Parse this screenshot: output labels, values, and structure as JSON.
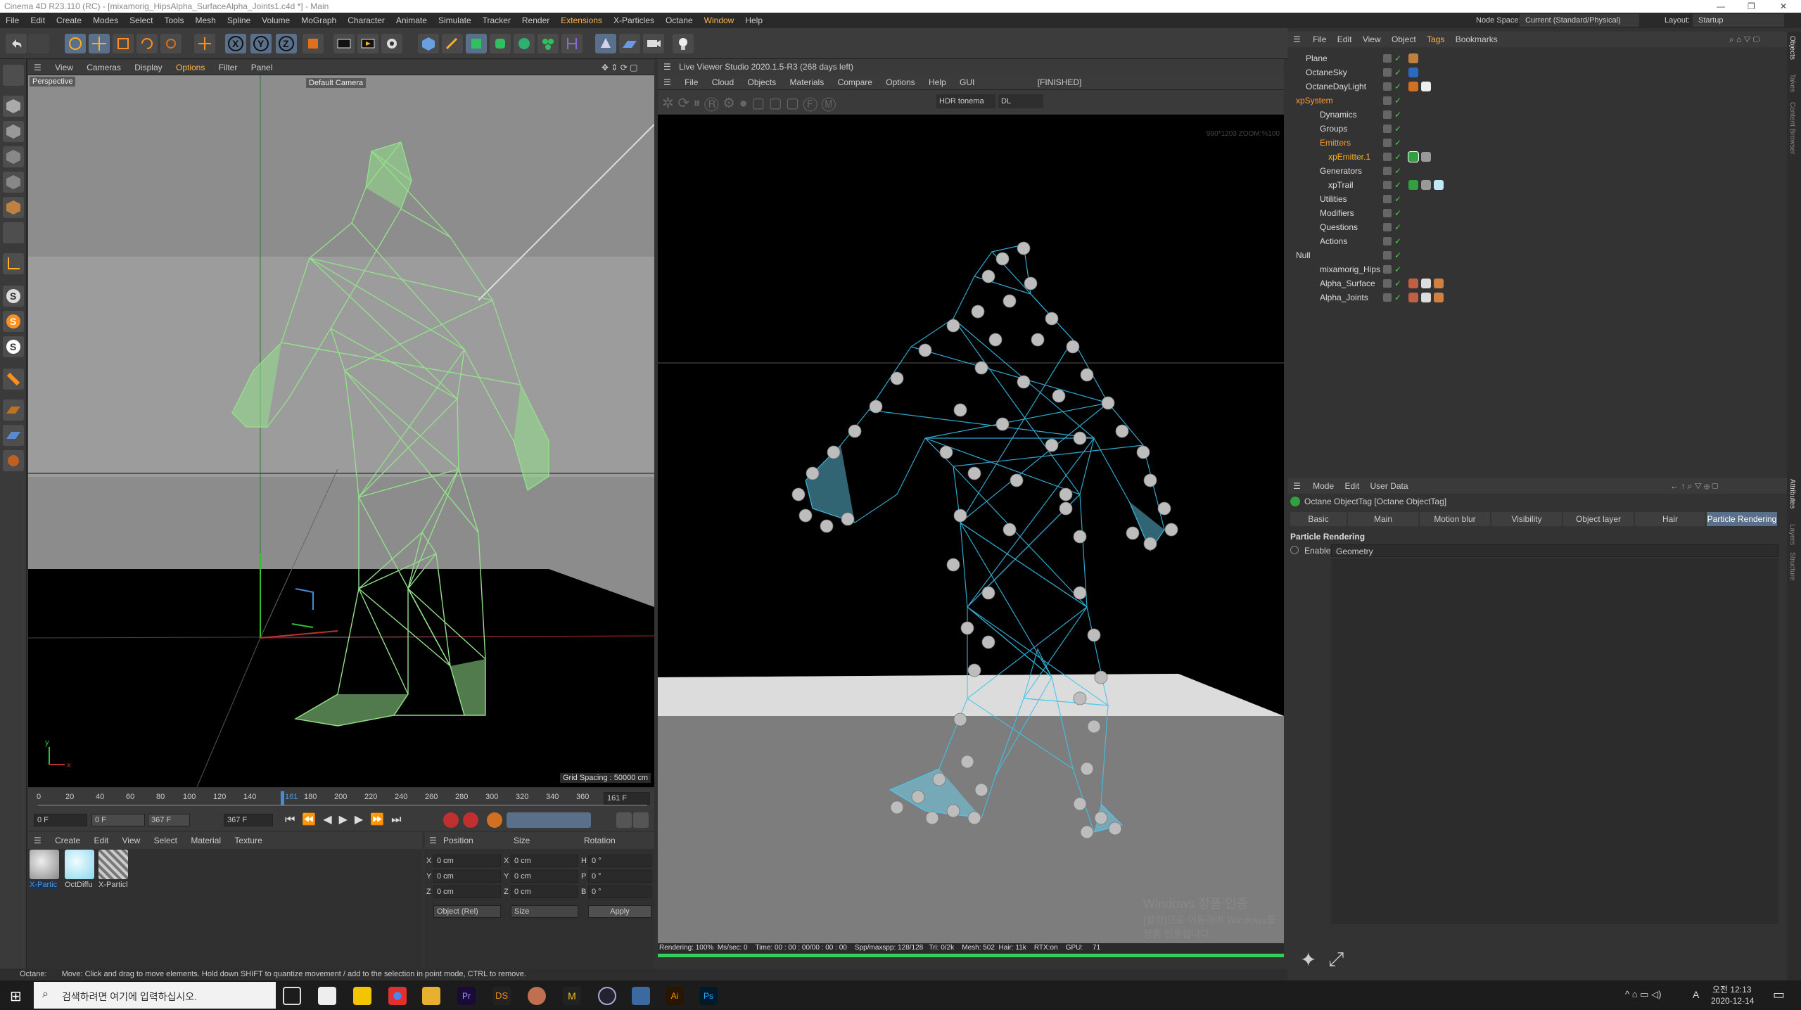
{
  "window": {
    "title": "Cinema 4D R23.110 (RC) - [mixamorig_HipsAlpha_SurfaceAlpha_Joints1.c4d *] - Main"
  },
  "menu": [
    "File",
    "Edit",
    "Create",
    "Modes",
    "Select",
    "Tools",
    "Mesh",
    "Spline",
    "Volume",
    "MoGraph",
    "Character",
    "Animate",
    "Simulate",
    "Tracker",
    "Render",
    "Extensions",
    "X-Particles",
    "Octane",
    "Window",
    "Help"
  ],
  "node_space": {
    "label": "Node Space:",
    "value": "Current (Standard/Physical)"
  },
  "layout": {
    "label": "Layout:",
    "value": "Startup"
  },
  "viewport": {
    "menu": [
      "View",
      "Cameras",
      "Display",
      "Options",
      "Filter",
      "Panel"
    ],
    "projection": "Perspective",
    "camera": "Default Camera",
    "grid": "Grid Spacing : 50000 cm"
  },
  "live_viewer": {
    "title": "Live Viewer Studio 2020.1.5-R3 (268 days left)",
    "menu": [
      "File",
      "Cloud",
      "Objects",
      "Materials",
      "Compare",
      "Options",
      "Help",
      "GUI"
    ],
    "status": "[FINISHED]",
    "tonemap": "HDR tonema",
    "kernel": "DL",
    "resolution": "980*1203 ZOOM:%100",
    "statusbar": "Rendering: 100%  Ms/sec: 0    Time: 00 : 00 : 00/00 : 00 : 00    Spp/maxspp: 128/128   Tri: 0/2k    Mesh: 502  Hair: 11k    RTX:on    GPU:     71"
  },
  "timeline": {
    "ticks": [
      "0",
      "20",
      "40",
      "60",
      "80",
      "100",
      "120",
      "140",
      "161",
      "180",
      "200",
      "220",
      "240",
      "260",
      "280",
      "300",
      "320",
      "340",
      "360"
    ],
    "current": "161 F",
    "start": "0 F",
    "min": "0 F",
    "max": "367 F",
    "end": "367 F"
  },
  "materials": {
    "menu": [
      "Create",
      "Edit",
      "View",
      "Select",
      "Material",
      "Texture"
    ],
    "items": [
      {
        "name": "X-Partic",
        "color": "#b9b9b9"
      },
      {
        "name": "OctDiffu",
        "color": "#d6f3fb"
      },
      {
        "name": "X-Particl",
        "color": "#9a9a9a"
      }
    ]
  },
  "coords": {
    "headers": [
      "Position",
      "Size",
      "Rotation"
    ],
    "rows": [
      {
        "axis": "X",
        "pos": "0 cm",
        "size_axis": "X",
        "size": "0 cm",
        "rot_axis": "H",
        "rot": "0 °"
      },
      {
        "axis": "Y",
        "pos": "0 cm",
        "size_axis": "Y",
        "size": "0 cm",
        "rot_axis": "P",
        "rot": "0 °"
      },
      {
        "axis": "Z",
        "pos": "0 cm",
        "size_axis": "Z",
        "size": "0 cm",
        "rot_axis": "B",
        "rot": "0 °"
      }
    ],
    "mode": "Object (Rel)",
    "size_mode": "Size",
    "apply": "Apply"
  },
  "objects": {
    "menu": [
      "File",
      "Edit",
      "View",
      "Object",
      "Tags",
      "Bookmarks"
    ],
    "items": [
      {
        "name": "Plane",
        "indent": 0,
        "color": "#ddd"
      },
      {
        "name": "OctaneSky",
        "indent": 0,
        "color": "#ddd"
      },
      {
        "name": "OctaneDayLight",
        "indent": 0,
        "color": "#ddd"
      },
      {
        "name": "xpSystem",
        "indent": 0,
        "color": "#ff9a30"
      },
      {
        "name": "Dynamics",
        "indent": 1,
        "color": "#ddd"
      },
      {
        "name": "Groups",
        "indent": 1,
        "color": "#ddd"
      },
      {
        "name": "Emitters",
        "indent": 1,
        "color": "#ff9a30"
      },
      {
        "name": "xpEmitter.1",
        "indent": 2,
        "color": "#ffb020"
      },
      {
        "name": "Generators",
        "indent": 1,
        "color": "#ddd"
      },
      {
        "name": "xpTrail",
        "indent": 2,
        "color": "#ddd"
      },
      {
        "name": "Utilities",
        "indent": 1,
        "color": "#ddd"
      },
      {
        "name": "Modifiers",
        "indent": 1,
        "color": "#ddd"
      },
      {
        "name": "Questions",
        "indent": 1,
        "color": "#ddd"
      },
      {
        "name": "Actions",
        "indent": 1,
        "color": "#ddd"
      },
      {
        "name": "Null",
        "indent": 0,
        "color": "#ddd"
      },
      {
        "name": "mixamorig_Hips",
        "indent": 1,
        "color": "#ddd"
      },
      {
        "name": "Alpha_Surface",
        "indent": 1,
        "color": "#ddd"
      },
      {
        "name": "Alpha_Joints",
        "indent": 1,
        "color": "#ddd"
      }
    ]
  },
  "attributes": {
    "menu": [
      "Mode",
      "Edit",
      "User Data"
    ],
    "object": "Octane ObjectTag [Octane ObjectTag]",
    "tabs": [
      "Basic",
      "Main",
      "Motion blur",
      "Visibility",
      "Object layer",
      "Hair",
      "Particle Rendering"
    ],
    "active_tab": "Particle Rendering",
    "section": "Particle Rendering",
    "enable_label": "Enable",
    "enable_value": "Geometry"
  },
  "side_tabs": [
    "Objects",
    "Takes",
    "Content Browser",
    "Attributes",
    "Layers",
    "Structure"
  ],
  "watermark": {
    "line1": "Windows 정품 인증",
    "line2": "[설정]으로 이동하여 Windows를 정품 인증합니다."
  },
  "status": {
    "prefix": "Octane:",
    "text": "Move: Click and drag to move elements. Hold down SHIFT to quantize movement / add to the selection in point mode, CTRL to remove."
  },
  "taskbar": {
    "search_placeholder": "검색하려면 여기에 입력하십시오.",
    "time": "오전 12:13",
    "date": "2020-12-14",
    "lang": "A"
  }
}
